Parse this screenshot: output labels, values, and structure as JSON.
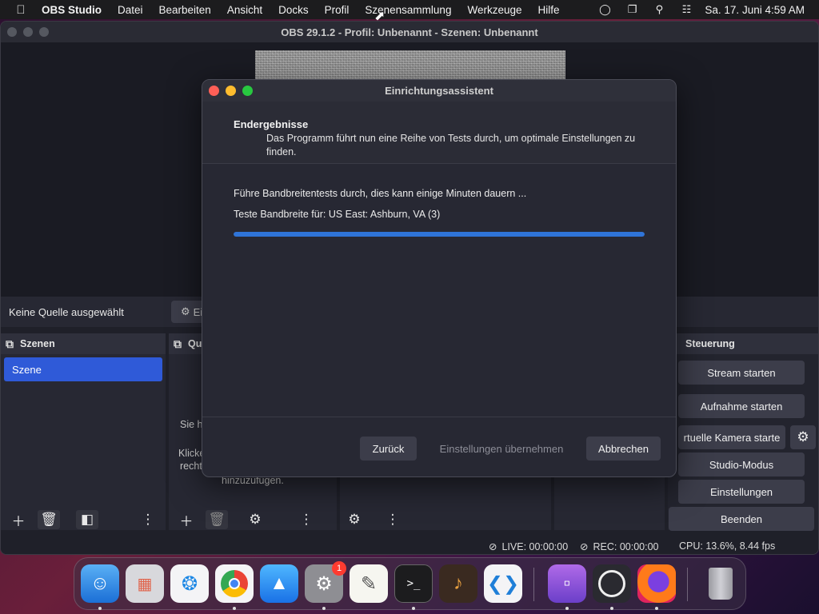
{
  "menubar": {
    "app_name": "OBS Studio",
    "items": [
      "Datei",
      "Bearbeiten",
      "Ansicht",
      "Docks",
      "Profil",
      "Szenensammlung",
      "Werkzeuge",
      "Hilfe"
    ],
    "clock": "Sa. 17. Juni  4:59 AM"
  },
  "window": {
    "title": "OBS 29.1.2 - Profil: Unbenannt - Szenen: Unbenannt"
  },
  "source_bar": {
    "no_source": "Keine Quelle ausgewählt",
    "props_label": "Ei"
  },
  "scenes": {
    "header": "Szenen",
    "items": [
      "Szene"
    ]
  },
  "sources": {
    "header": "Qu",
    "hint1": "Sie h",
    "hint2a": "Klicke",
    "hint2b": "recht",
    "hint3": "hinzuzufügen."
  },
  "controls": {
    "header": "Steuerung",
    "stream": "Stream starten",
    "record": "Aufnahme starten",
    "vcam": "rtuelle Kamera starte",
    "studio": "Studio-Modus",
    "settings": "Einstellungen",
    "exit": "Beenden"
  },
  "status": {
    "live": "LIVE: 00:00:00",
    "rec": "REC: 00:00:00",
    "cpu": "CPU: 13.6%, 8.44 fps"
  },
  "wizard": {
    "title": "Einrichtungsassistent",
    "page_title": "Endergebnisse",
    "page_subtitle": "Das Programm führt nun eine Reihe von Tests durch, um optimale Einstellungen zu finden.",
    "line1": "Führe Bandbreitentests durch, dies kann einige Minuten dauern ...",
    "line2": "Teste Bandbreite für: US East: Ashburn, VA (3)",
    "progress": 1.0,
    "back": "Zurück",
    "apply": "Einstellungen übernehmen",
    "cancel": "Abbrechen"
  },
  "dock": {
    "settings_badge": "1",
    "apps": [
      "finder-icon",
      "launchpad-icon",
      "safari-icon",
      "chrome-icon",
      "app-store-icon",
      "system-settings-icon",
      "textedit-icon",
      "terminal-icon",
      "garageband-icon",
      "vscode-icon",
      "podcasts-icon",
      "obs-icon",
      "firefox-icon",
      "trash-icon"
    ]
  },
  "colors": {
    "accent": "#2f74d8",
    "scene_selected": "#2f5ad8",
    "panel": "#272833"
  }
}
